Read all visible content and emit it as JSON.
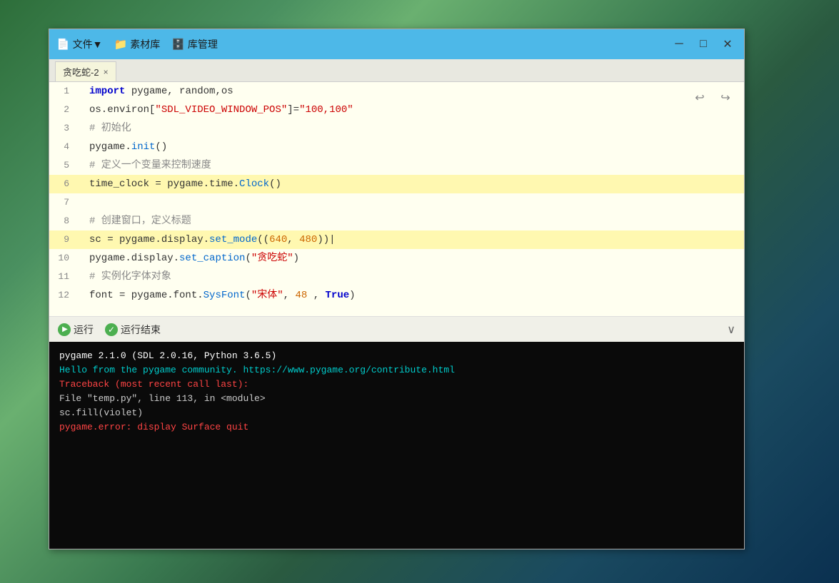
{
  "background": {
    "desc": "scenic landscape background"
  },
  "window": {
    "titlebar": {
      "menu_items": [
        {
          "id": "file",
          "icon": "📄",
          "label": "文件▼"
        },
        {
          "id": "assets",
          "icon": "📁",
          "label": "素材库"
        },
        {
          "id": "library",
          "icon": "🗄️",
          "label": "库管理"
        }
      ],
      "controls": [
        {
          "id": "minimize",
          "symbol": "─"
        },
        {
          "id": "maximize",
          "symbol": "□"
        },
        {
          "id": "close",
          "symbol": "✕"
        }
      ]
    },
    "tab": {
      "label": "贪吃蛇-2",
      "close": "×"
    },
    "undo_label": "↩",
    "redo_label": "↪",
    "code_lines": [
      {
        "num": 1,
        "content": "import pygame, random,os",
        "type": "import"
      },
      {
        "num": 2,
        "content": "os.environ[\"SDL_VIDEO_WINDOW_POS\"]=\"100,100\"",
        "type": "assign"
      },
      {
        "num": 3,
        "content": "# 初始化",
        "type": "comment"
      },
      {
        "num": 4,
        "content": "pygame.init()",
        "type": "call"
      },
      {
        "num": 5,
        "content": "# 定义一个变量来控制速度",
        "type": "comment"
      },
      {
        "num": 6,
        "content": "time_clock = pygame.time.Clock()",
        "type": "assign",
        "highlight": true
      },
      {
        "num": 7,
        "content": "",
        "type": "empty"
      },
      {
        "num": 8,
        "content": "# 创建窗口，定义标题",
        "type": "comment"
      },
      {
        "num": 9,
        "content": "sc = pygame.display.set_mode((640, 480))",
        "type": "assign",
        "highlight": true
      },
      {
        "num": 10,
        "content": "pygame.display.set_caption(\"贪吃蛇\")",
        "type": "call"
      },
      {
        "num": 11,
        "content": "# 实例化字体对象",
        "type": "comment"
      },
      {
        "num": 12,
        "content": "font = pygame.font.SysFont(\"宋体\", 48 , True)",
        "type": "assign"
      }
    ],
    "actions": {
      "run_label": "运行",
      "stop_label": "运行结束"
    },
    "terminal_lines": [
      {
        "text": "pygame 2.1.0 (SDL 2.0.16, Python 3.6.5)",
        "color": "white"
      },
      {
        "text": "Hello from the pygame community. https://www.pygame.org/contribute.html",
        "color": "cyan"
      },
      {
        "text": "Traceback (most recent call last):",
        "color": "red"
      },
      {
        "text": "  File \"temp.py\", line 113, in <module>",
        "color": "gray"
      },
      {
        "text": "    sc.fill(violet)",
        "color": "gray"
      },
      {
        "text": "pygame.error: display Surface quit",
        "color": "red"
      }
    ]
  }
}
